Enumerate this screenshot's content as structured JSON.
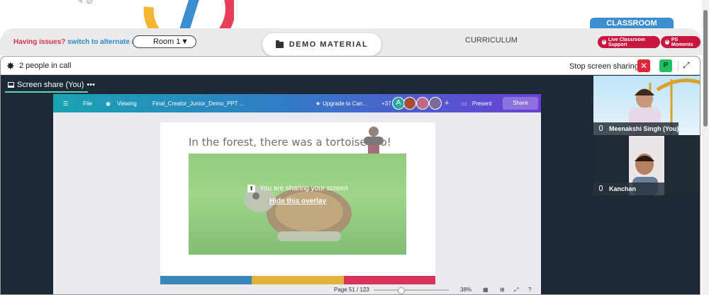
{
  "header": {
    "issue_text": "Having issues?",
    "switch_link": "switch to alternate room",
    "room_value": "Room 1",
    "caret": "▼",
    "demo_label": "DEMO MATERIAL",
    "curriculum_label": "CURRICULUM",
    "classroom_tab": "CLASSROOM",
    "live_support": "Live Classroom Support",
    "ps_moments": "PS Moments"
  },
  "call": {
    "people_count_text": "2 people in call",
    "stop_share": "Stop screen sharing",
    "p_label": "P",
    "screen_share_tab": "Screen share (You)",
    "tab_menu": "•••"
  },
  "canva": {
    "file": "File",
    "viewing": "Viewing",
    "filename": "Final_Creator_Junior_Demo_PPT ...",
    "upgrade": "Upgrade to Can...",
    "collab_count": "+37",
    "avatar_initial": "A",
    "present": "Present",
    "share": "Share",
    "page_indicator": "Page 51 / 123",
    "zoom": "38%"
  },
  "slide": {
    "title": "In the forest, there was a tortoise too!"
  },
  "overlay": {
    "message": "You are sharing your screen",
    "hide": "Hide this overlay"
  },
  "videos": [
    {
      "name": "Meenakshi Singh (You)"
    },
    {
      "name": "Kanchan"
    }
  ],
  "colors": {
    "accent_red": "#c8163f",
    "classroom_blue": "#3b8ed0",
    "stripe1": "#3a86b8",
    "stripe2": "#e2b33c",
    "stripe3": "#d6335b"
  }
}
